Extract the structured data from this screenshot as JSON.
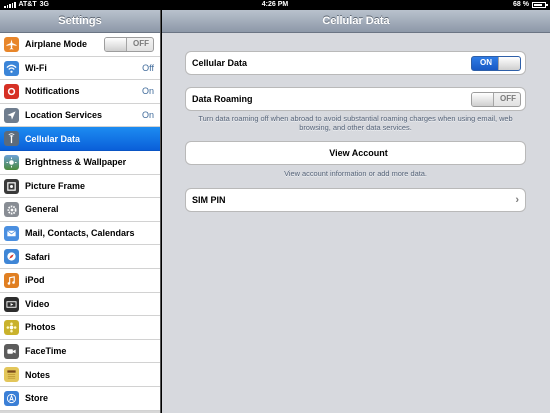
{
  "status": {
    "carrier": "AT&T",
    "network": "3G",
    "time": "4:26 PM",
    "battery": "68 %"
  },
  "sidebar": {
    "title": "Settings",
    "items": [
      {
        "label": "Airplane Mode",
        "toggle": "OFF",
        "icon": "airplane-icon",
        "color": "#e8862a"
      },
      {
        "label": "Wi-Fi",
        "value": "Off",
        "icon": "wifi-icon",
        "color": "#3b85d8"
      },
      {
        "label": "Notifications",
        "value": "On",
        "icon": "notifications-icon",
        "color": "#d63125"
      },
      {
        "label": "Location Services",
        "value": "On",
        "icon": "location-icon",
        "color": "#6f7d8e"
      },
      {
        "label": "Cellular Data",
        "icon": "cellular-icon",
        "color": "#5c6b7c",
        "selected": true
      },
      {
        "label": "Brightness & Wallpaper",
        "icon": "brightness-icon",
        "color": "#4b8a3a"
      },
      {
        "label": "Picture Frame",
        "icon": "picture-frame-icon",
        "color": "#3a3a3a"
      },
      {
        "label": "General",
        "icon": "gear-icon",
        "color": "#888d94"
      },
      {
        "label": "Mail, Contacts, Calendars",
        "icon": "mail-icon",
        "color": "#4a8fe0"
      },
      {
        "label": "Safari",
        "icon": "safari-icon",
        "color": "#3f86d6"
      },
      {
        "label": "iPod",
        "icon": "ipod-icon",
        "color": "#e07f22"
      },
      {
        "label": "Video",
        "icon": "video-icon",
        "color": "#2d2d2d"
      },
      {
        "label": "Photos",
        "icon": "photos-icon",
        "color": "#c9b22c"
      },
      {
        "label": "FaceTime",
        "icon": "facetime-icon",
        "color": "#5c5c5c"
      },
      {
        "label": "Notes",
        "icon": "notes-icon",
        "color": "#e3c65a"
      },
      {
        "label": "Store",
        "icon": "store-icon",
        "color": "#3b7fd6"
      }
    ]
  },
  "main": {
    "title": "Cellular Data",
    "cellular_data": {
      "label": "Cellular Data",
      "toggle": "ON"
    },
    "data_roaming": {
      "label": "Data Roaming",
      "toggle": "OFF"
    },
    "roaming_note": "Turn data roaming off when abroad to avoid substantial roaming charges when using email, web browsing, and other data services.",
    "view_account": {
      "label": "View Account"
    },
    "account_note": "View account information or add more data.",
    "sim_pin": {
      "label": "SIM PIN"
    }
  }
}
